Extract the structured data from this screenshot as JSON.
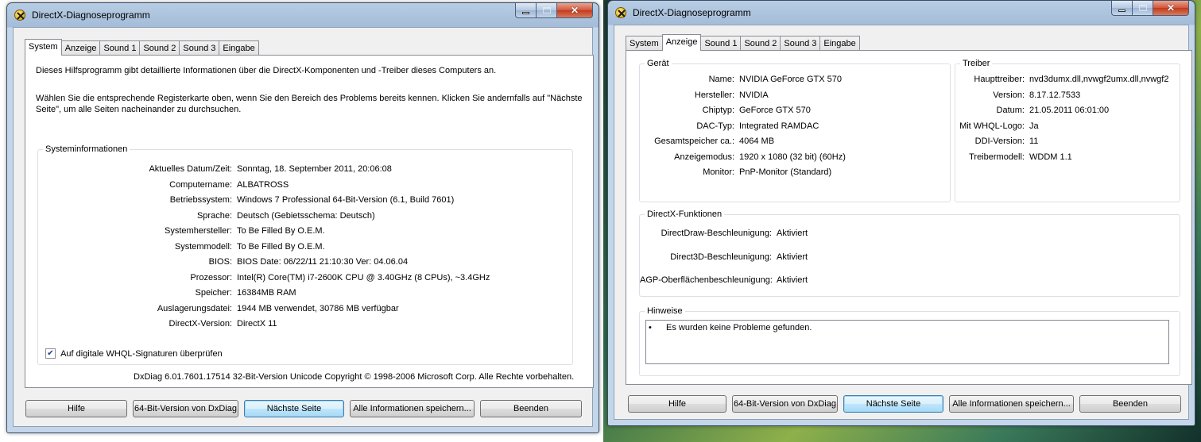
{
  "left_window": {
    "title": "DirectX-Diagnoseprogramm",
    "tabs": [
      "System",
      "Anzeige",
      "Sound 1",
      "Sound 2",
      "Sound 3",
      "Eingabe"
    ],
    "intro_1": "Dieses Hilfsprogramm gibt detaillierte Informationen über die DirectX-Komponenten und -Treiber dieses Computers an.",
    "intro_2a": "Wählen Sie die entsprechende Registerkarte oben, wenn Sie den Bereich des Problems bereits kennen. Klicken Sie andernfalls auf \"Nächste",
    "intro_2b": "Seite\", um alle Seiten nacheinander zu durchsuchen.",
    "sysinfo_legend": "Systeminformationen",
    "sysinfo": [
      {
        "k": "Aktuelles Datum/Zeit:",
        "v": "Sonntag, 18. September 2011, 20:06:08"
      },
      {
        "k": "Computername:",
        "v": "ALBATROSS"
      },
      {
        "k": "Betriebssystem:",
        "v": "Windows 7 Professional 64-Bit-Version (6.1, Build 7601)"
      },
      {
        "k": "Sprache:",
        "v": "Deutsch (Gebietsschema: Deutsch)"
      },
      {
        "k": "Systemhersteller:",
        "v": "To Be Filled By O.E.M."
      },
      {
        "k": "Systemmodell:",
        "v": "To Be Filled By O.E.M."
      },
      {
        "k": "BIOS:",
        "v": "BIOS Date: 06/22/11 21:10:30 Ver: 04.06.04"
      },
      {
        "k": "Prozessor:",
        "v": "Intel(R) Core(TM) i7-2600K CPU @ 3.40GHz (8 CPUs), ~3.4GHz"
      },
      {
        "k": "Speicher:",
        "v": "16384MB RAM"
      },
      {
        "k": "Auslagerungsdatei:",
        "v": "1944 MB verwendet, 30786 MB verfügbar"
      },
      {
        "k": "DirectX-Version:",
        "v": "DirectX 11"
      }
    ],
    "whql_check_label": "Auf digitale WHQL-Signaturen überprüfen",
    "copyright": "DxDiag 6.01.7601.17514 32-Bit-Version Unicode Copyright © 1998-2006 Microsoft Corp. Alle Rechte vorbehalten.",
    "buttons": [
      "Hilfe",
      "64-Bit-Version von DxDiag",
      "Nächste Seite",
      "Alle Informationen speichern...",
      "Beenden"
    ]
  },
  "right_window": {
    "title": "DirectX-Diagnoseprogramm",
    "tabs": [
      "System",
      "Anzeige",
      "Sound 1",
      "Sound 2",
      "Sound 3",
      "Eingabe"
    ],
    "device_legend": "Gerät",
    "device": [
      {
        "k": "Name:",
        "v": "NVIDIA GeForce GTX 570"
      },
      {
        "k": "Hersteller:",
        "v": "NVIDIA"
      },
      {
        "k": "Chiptyp:",
        "v": "GeForce GTX 570"
      },
      {
        "k": "DAC-Typ:",
        "v": "Integrated RAMDAC"
      },
      {
        "k": "Gesamtspeicher ca.:",
        "v": "4064 MB"
      },
      {
        "k": "Anzeigemodus:",
        "v": "1920 x 1080 (32 bit) (60Hz)"
      },
      {
        "k": "Monitor:",
        "v": "PnP-Monitor (Standard)"
      }
    ],
    "driver_legend": "Treiber",
    "driver": [
      {
        "k": "Haupttreiber:",
        "v": "nvd3dumx.dll,nvwgf2umx.dll,nvwgf2"
      },
      {
        "k": "Version:",
        "v": "8.17.12.7533"
      },
      {
        "k": "Datum:",
        "v": "21.05.2011 06:01:00"
      },
      {
        "k": "Mit WHQL-Logo:",
        "v": "Ja"
      },
      {
        "k": "DDI-Version:",
        "v": "11"
      },
      {
        "k": "Treibermodell:",
        "v": "WDDM 1.1"
      }
    ],
    "features_legend": "DirectX-Funktionen",
    "features": [
      {
        "k": "DirectDraw-Beschleunigung:",
        "v": "Aktiviert"
      },
      {
        "k": "Direct3D-Beschleunigung:",
        "v": "Aktiviert"
      },
      {
        "k": "AGP-Oberflächenbeschleunigung:",
        "v": "Aktiviert"
      }
    ],
    "notes_legend": "Hinweise",
    "notes_bullet": "•",
    "notes_text": "Es wurden keine Probleme gefunden.",
    "buttons": [
      "Hilfe",
      "64-Bit-Version von DxDiag",
      "Nächste Seite",
      "Alle Informationen speichern...",
      "Beenden"
    ]
  },
  "colors": {
    "window_frame": "#a4bcd8",
    "client_bg": "#f0f0f0",
    "close_button": "#c23a1c"
  },
  "icons": [
    "directx-icon",
    "minimize-icon",
    "maximize-icon",
    "close-icon",
    "checkmark-icon"
  ]
}
